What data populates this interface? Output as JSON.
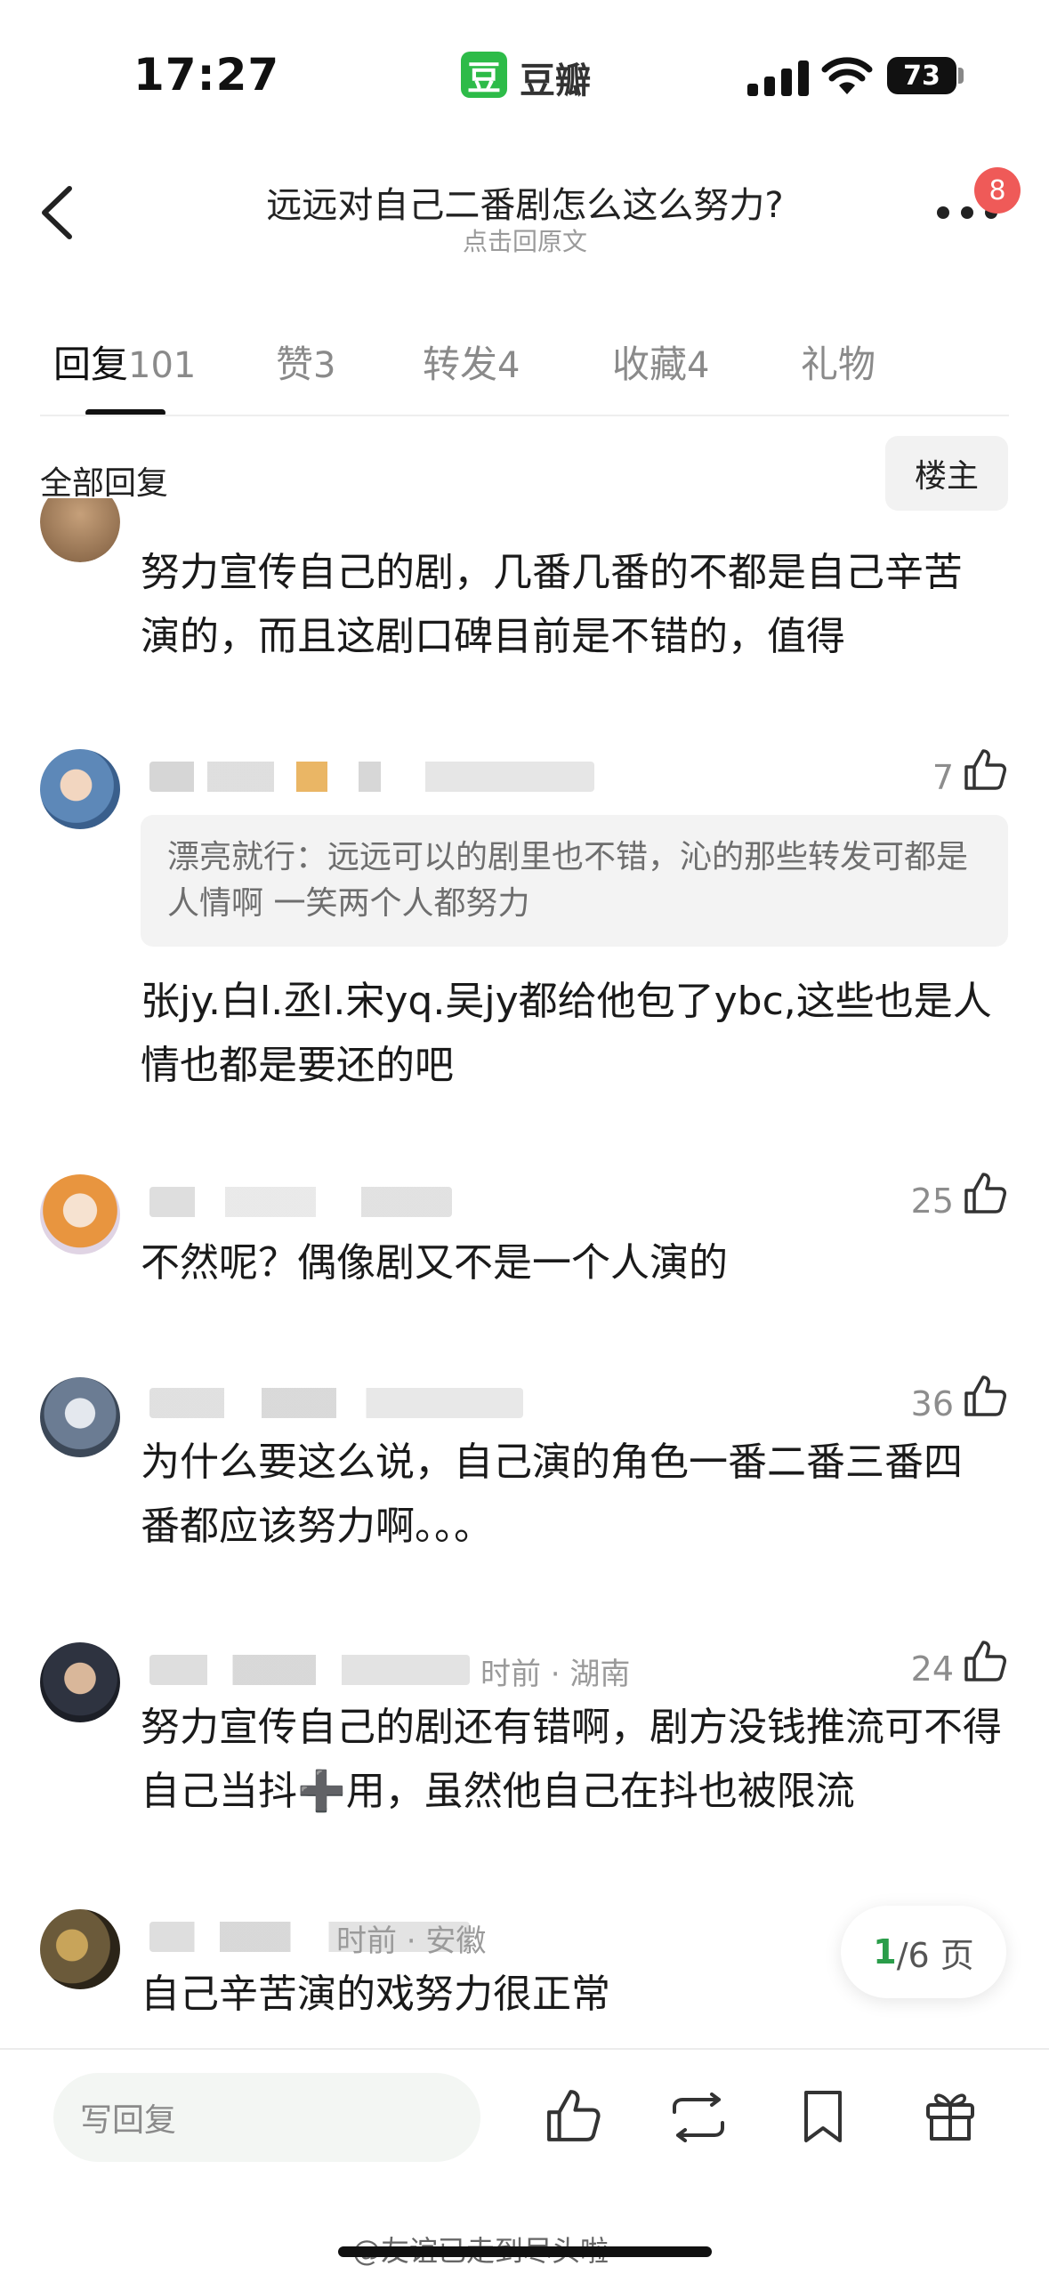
{
  "status_bar": {
    "time": "17:27",
    "app_badge": "豆",
    "app_name": "豆瓣",
    "battery": "73"
  },
  "header": {
    "title": "远远对自己二番剧怎么这么努力?",
    "subtitle": "点击回原文",
    "notification_count": "8"
  },
  "tabs": [
    {
      "label": "回复",
      "count": "101",
      "active": true
    },
    {
      "label": "赞",
      "count": "3",
      "active": false
    },
    {
      "label": "转发",
      "count": "4",
      "active": false
    },
    {
      "label": "收藏",
      "count": "4",
      "active": false
    },
    {
      "label": "礼物",
      "count": "",
      "active": false
    }
  ],
  "section": {
    "label": "全部回复",
    "op_button": "楼主"
  },
  "comments": [
    {
      "text": "努力宣传自己的剧，几番几番的不都是自己辛苦演的，而且这剧口碑目前是不错的，值得",
      "likes": ""
    },
    {
      "quote": "漂亮就行：远远可以的剧里也不错，沁的那些转发可都是人情啊 一笑两个人都努力",
      "text": "张jy.白l.丞l.宋yq.吴jy都给他包了ybc,这些也是人情也都是要还的吧",
      "likes": "7"
    },
    {
      "text": "不然呢？偶像剧又不是一个人演的",
      "likes": "25"
    },
    {
      "text": "为什么要这么说，自己演的角色一番二番三番四番都应该努力啊。。。",
      "likes": "36"
    },
    {
      "meta": "时前 · 湖南",
      "text": "努力宣传自己的剧还有错啊，剧方没钱推流可不得自己当抖➕用，虽然他自己在抖也被限流",
      "likes": "24"
    },
    {
      "meta": "时前 · 安徽",
      "text": "自己辛苦演的戏努力很正常",
      "likes": ""
    }
  ],
  "pager": {
    "current": "1",
    "total_label": "/6 页"
  },
  "bottom_bar": {
    "reply_placeholder": "写回复"
  },
  "watermark": "@友谊已走到尽头啦",
  "colors": {
    "brand_green": "#2dbb48",
    "pager_green": "#2a9d4a",
    "badge_red": "#ef5a58"
  }
}
